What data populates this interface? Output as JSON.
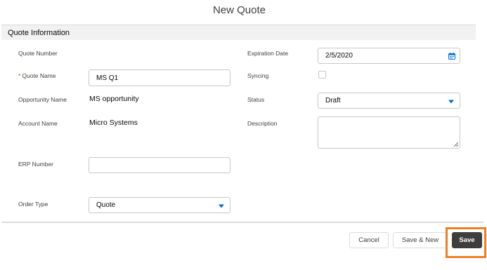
{
  "modal": {
    "title": "New Quote"
  },
  "section": {
    "title": "Quote Information"
  },
  "fields": {
    "quote_number": {
      "label": "Quote Number"
    },
    "quote_name": {
      "required_marker": "*",
      "label": "Quote Name",
      "value": "MS Q1"
    },
    "opportunity_name": {
      "label": "Opportunity Name",
      "value": "MS opportunity"
    },
    "account_name": {
      "label": "Account Name",
      "value": "Micro Systems"
    },
    "erp_number": {
      "label": "ERP Number",
      "value": ""
    },
    "order_type": {
      "label": "Order Type",
      "value": "Quote"
    },
    "expiration_date": {
      "label": "Expiration Date",
      "value": "2/5/2020"
    },
    "syncing": {
      "label": "Syncing",
      "checked": false
    },
    "status": {
      "label": "Status",
      "value": "Draft"
    },
    "description": {
      "label": "Description",
      "value": ""
    }
  },
  "footer": {
    "cancel_label": "Cancel",
    "save_new_label": "Save & New",
    "save_label": "Save"
  },
  "colors": {
    "accent": "#0070d2",
    "highlight": "#f07e25",
    "save_button": "#3e3e3c"
  }
}
